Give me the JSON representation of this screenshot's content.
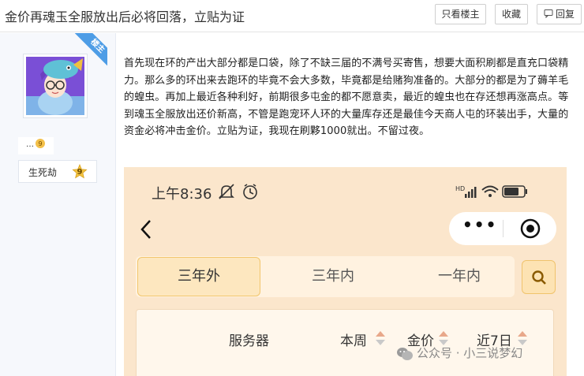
{
  "thread": {
    "title": "金价再魂玉全服放出后必将回落，立贴为证"
  },
  "toolbar": {
    "only_op_label": "只看楼主",
    "favorite_label": "收藏",
    "reply_label": "回复"
  },
  "author": {
    "tag_label": "楼主",
    "username": "…",
    "level_name": "生死劫",
    "level_num": "9"
  },
  "post": {
    "text": "首先现在环的产出大部分都是口袋，除了不缺三届的不满号买寄售，想要大面积刷都是直充口袋精力。那么多的环出来去跑环的毕竟不会大多数，毕竟都是给赌狗准备的。大部分的都是为了薅羊毛的蝗虫。再加上最近各种利好，前期很多屯金的都不愿意卖，最近的蝗虫也在存还想再涨高点。等到魂玉全服放出还价新高，不管是跑宠环人环的大量库存还是最佳今天商人屯的环装出手，大量的资金必将冲击金价。立贴为证，我现在刷夥1000就出。不留过夜。"
  },
  "phone": {
    "time": "上午8:36",
    "battery": "70",
    "tabs": [
      "三年外",
      "三年内",
      "一年内"
    ],
    "table_headers": {
      "server": "服务器",
      "week": "本周",
      "price": "金价",
      "last7": "近7日"
    },
    "watermark": "公众号 · 小三说梦幻"
  },
  "colors": {
    "phone_bg": "#fbe6cc",
    "tab_active_border": "#f2c66d",
    "accent_blue": "#4e9de6"
  }
}
